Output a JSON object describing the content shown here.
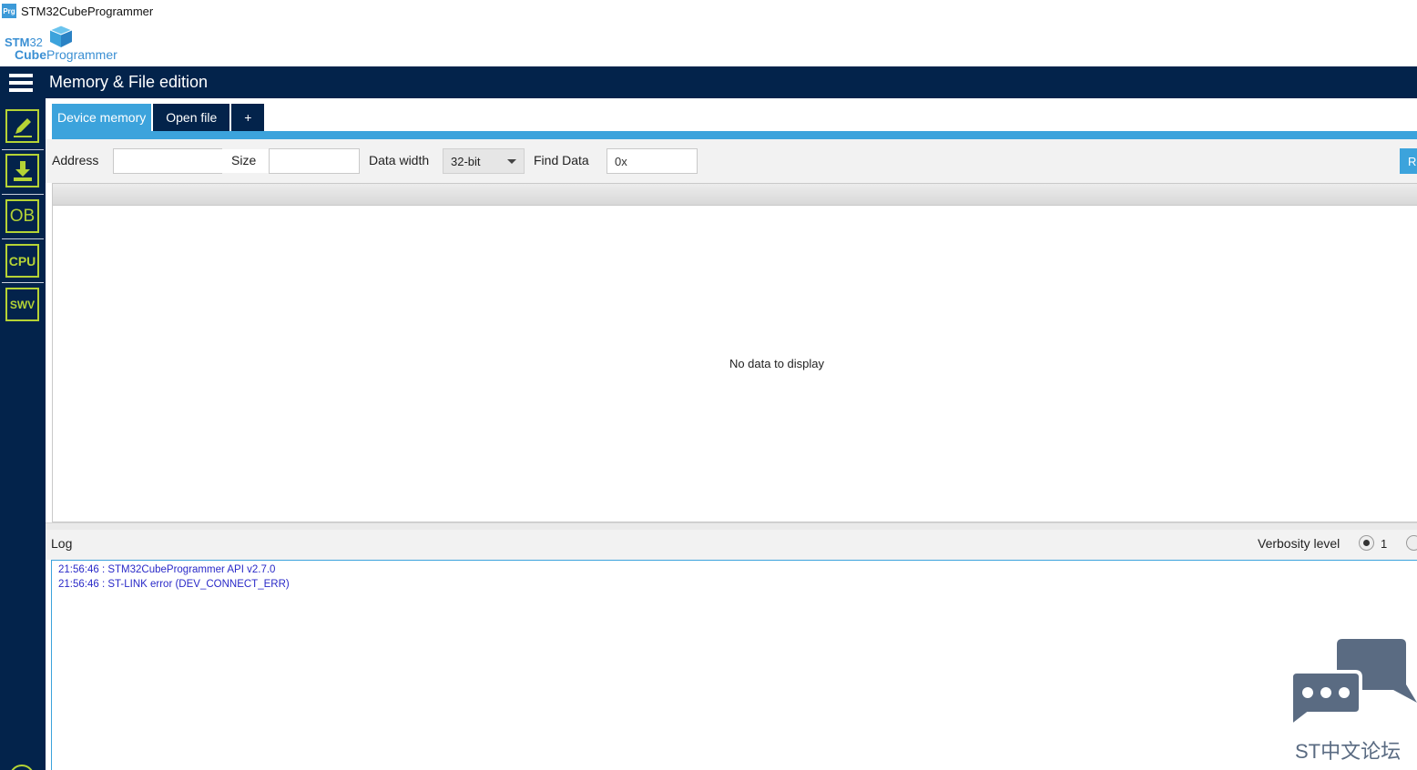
{
  "window": {
    "title": "STM32CubeProgrammer",
    "app_icon": "Prg"
  },
  "logo": {
    "line1_bold": "STM",
    "line1_thin": "32",
    "line2_bold": "Cube",
    "line2_thin": "Programmer"
  },
  "header": {
    "title": "Memory & File edition"
  },
  "sidebar": {
    "items": [
      {
        "name": "memory-edit",
        "icon": "pencil-icon"
      },
      {
        "name": "erase-programming",
        "icon": "download-icon"
      },
      {
        "name": "option-bytes",
        "label": "OB"
      },
      {
        "name": "cpu",
        "label": "CPU"
      },
      {
        "name": "swv",
        "label": "SWV"
      }
    ]
  },
  "tabs": [
    {
      "label": "Device memory",
      "active": true
    },
    {
      "label": "Open file",
      "active": false
    },
    {
      "label": "+",
      "active": false
    }
  ],
  "toolbar": {
    "address_label": "Address",
    "address_value": "",
    "size_label": "Size",
    "size_value": "",
    "data_width_label": "Data width",
    "data_width_value": "32-bit",
    "find_label": "Find Data",
    "find_value": "0x",
    "read_button": "Read"
  },
  "grid": {
    "empty_text": "No data to display"
  },
  "log": {
    "label": "Log",
    "verbosity_label": "Verbosity level",
    "verbosity_value": "1",
    "lines": [
      "21:56:46 : STM32CubeProgrammer API v2.7.0",
      "21:56:46 : ST-LINK error (DEV_CONNECT_ERR)"
    ]
  },
  "watermark": {
    "text": "ST中文论坛"
  },
  "colors": {
    "navy": "#03234b",
    "accent": "#3ca3dc",
    "lime": "#b5d335",
    "log_text": "#2a2ac8"
  }
}
